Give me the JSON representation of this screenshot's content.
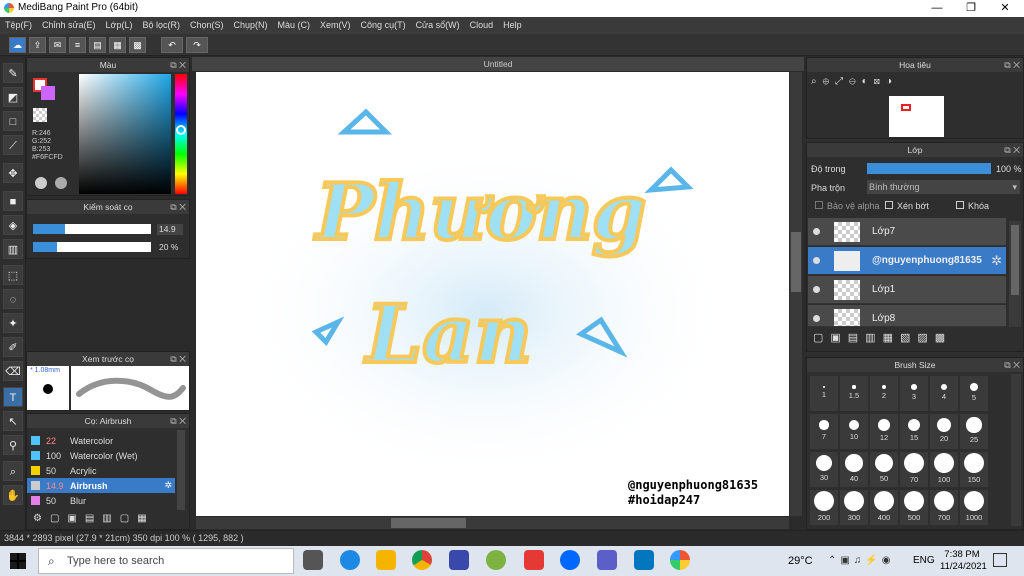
{
  "window": {
    "title": "MediBang Paint Pro (64bit)",
    "minimize": "—",
    "maximize": "❐",
    "close": "✕"
  },
  "menu": [
    "Tệp(F)",
    "Chỉnh sửa(E)",
    "Lớp(L)",
    "Bộ lọc(R)",
    "Chọn(S)",
    "Chụp(N)",
    "Màu (C)",
    "Xem(V)",
    "Công cụ(T)",
    "Cửa sổ(W)",
    "Cloud",
    "Help"
  ],
  "color_panel": {
    "title": "Màu",
    "r": "R:246",
    "g": "G:252",
    "b": "B:253",
    "hex": "#F6FCFD"
  },
  "brush_control": {
    "title": "Kiểm soát cọ",
    "size": "14.9",
    "opacity": "20 %",
    "size_fill": 0.27,
    "opacity_fill": 0.2
  },
  "preview": {
    "title": "Xem trước cọ",
    "size": "1.08mm"
  },
  "brush_list": {
    "title": "Cọ: Airbrush",
    "items": [
      {
        "n": "22",
        "name": "Watercolor",
        "color": "#4fc3f7"
      },
      {
        "n": "100",
        "name": "Watercolor (Wet)",
        "color": "#4fc3f7"
      },
      {
        "n": "50",
        "name": "Acrylic",
        "color": "#f5d000"
      },
      {
        "n": "14.9",
        "name": "Airbrush",
        "color": "#ccc",
        "selected": true
      },
      {
        "n": "50",
        "name": "Blur",
        "color": "#e67fe6"
      }
    ]
  },
  "document": {
    "tab": "Untitled",
    "text_line1": "Phương",
    "text_line2": "Lan",
    "watermark1": "@nguyenphuong81635",
    "watermark2": "#hoidap247"
  },
  "navigator": {
    "title": "Hoa tiêu"
  },
  "layer_panel": {
    "title": "Lớp",
    "opacity_label": "Độ trong",
    "opacity_value": "100 %",
    "blend_label": "Pha trộn",
    "blend_value": "Bình thường",
    "protect_alpha": "Bảo vệ alpha",
    "clip": "Xén bớt",
    "lock": "Khóa",
    "layers": [
      {
        "name": "Lớp7",
        "selected": false
      },
      {
        "name": "@nguyenphuong81635",
        "selected": true
      },
      {
        "name": "Lớp1",
        "selected": false
      },
      {
        "name": "Lớp8",
        "selected": false
      }
    ]
  },
  "brush_size": {
    "title": "Brush Size",
    "sizes": [
      "1",
      "1.5",
      "2",
      "3",
      "4",
      "5",
      "7",
      "10",
      "12",
      "15",
      "20",
      "25",
      "30",
      "40",
      "50",
      "70",
      "100",
      "150",
      "200",
      "300",
      "400",
      "500",
      "700",
      "1000"
    ]
  },
  "status": "3844 * 2893 pixel  (27.9 * 21cm)  350 dpi  100 %  ( 1295, 882 )",
  "taskbar": {
    "search": "Type here to search",
    "weather": "29°C",
    "lang": "ENG",
    "time": "7:38 PM",
    "date": "11/24/2021"
  }
}
